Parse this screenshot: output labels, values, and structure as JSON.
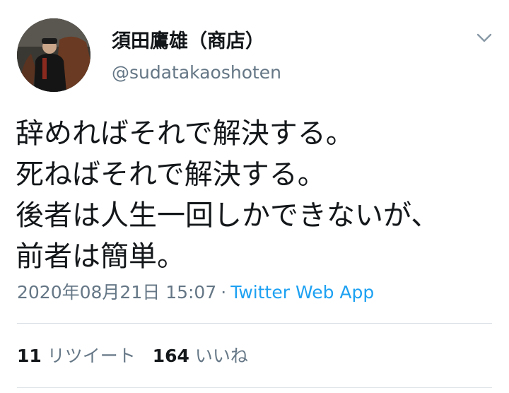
{
  "user": {
    "display_name": "須田鷹雄（商店）",
    "handle": "@sudatakaoshoten",
    "avatar_icon": "profile-photo-person-with-horse"
  },
  "menu_icon": "chevron-down-icon",
  "tweet": {
    "lines": [
      "辞めればそれで解決する。",
      "死ねばそれで解決する。",
      "後者は人生一回しかできないが、",
      "前者は簡単。"
    ],
    "timestamp": "2020年08月21日 15:07",
    "separator": "·",
    "source": "Twitter Web App"
  },
  "stats": {
    "retweets_count": "11",
    "retweets_label": "リツイート",
    "likes_count": "164",
    "likes_label": "いいね"
  },
  "colors": {
    "text": "#14171a",
    "secondary": "#657786",
    "link": "#1da1f2",
    "divider": "#dbe1e6"
  }
}
